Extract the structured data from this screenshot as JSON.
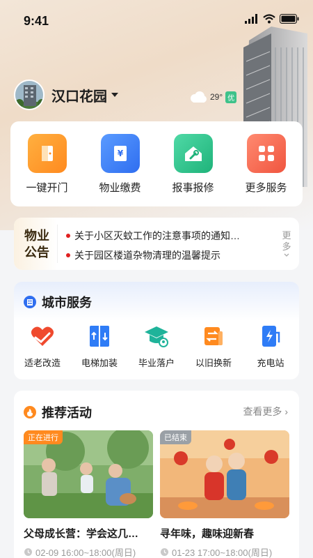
{
  "status": {
    "time": "9:41"
  },
  "header": {
    "community": "汉口花园",
    "temp": "29°",
    "aqi": "优"
  },
  "quick": [
    {
      "label": "一键开门",
      "icon": "door-icon"
    },
    {
      "label": "物业缴费",
      "icon": "yen-bill-icon"
    },
    {
      "label": "报事报修",
      "icon": "home-repair-icon"
    },
    {
      "label": "更多服务",
      "icon": "grid-icon"
    }
  ],
  "notice": {
    "title_line1": "物业",
    "title_line2": "公告",
    "items": [
      "关于小区灭蚊工作的注意事项的通知…",
      "关于园区楼道杂物清理的温馨提示"
    ],
    "more_line1": "更",
    "more_line2": "多"
  },
  "city": {
    "title": "城市服务",
    "items": [
      {
        "label": "适老改造",
        "icon": "heart-hand-icon"
      },
      {
        "label": "电梯加装",
        "icon": "elevator-icon"
      },
      {
        "label": "毕业落户",
        "icon": "graduation-cap-icon"
      },
      {
        "label": "以旧换新",
        "icon": "exchange-icon"
      },
      {
        "label": "充电站",
        "icon": "charging-icon"
      }
    ]
  },
  "activity": {
    "title": "推荐活动",
    "more": "查看更多",
    "cards": [
      {
        "tag": "正在进行",
        "title": "父母成长营：学会这几…",
        "time": "02-09 16:00~18:00(周日)"
      },
      {
        "tag": "已结束",
        "title": "寻年味，趣味迎新春",
        "time": "01-23 17:00~18:00(周日)"
      }
    ]
  },
  "colors": {
    "accent_orange": "#ff8a1f",
    "accent_blue": "#2f7cf6",
    "accent_green": "#29c28b",
    "accent_red": "#f0553f"
  }
}
